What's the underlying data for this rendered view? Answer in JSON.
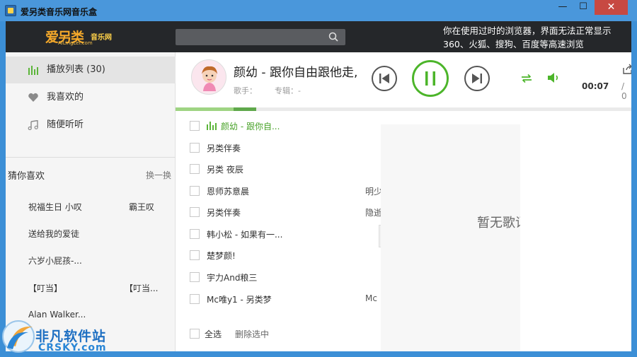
{
  "window": {
    "title": "爱另类音乐网音乐盒",
    "minimize": "—",
    "maximize": "☐",
    "close": "✕"
  },
  "header": {
    "logo_text": "爱另类",
    "logo_badge": "音乐网",
    "logo_sub": "AiLingLei.com",
    "search_placeholder": "",
    "warning_line1": "你在使用过时的浏览器，界面无法正常显示",
    "warning_line2": "360、火狐、搜狗、百度等高速浏览"
  },
  "sidebar": {
    "nav": [
      {
        "label": "播放列表 (30)",
        "icon": "equalizer-icon"
      },
      {
        "label": "我喜欢的",
        "icon": "heart-icon"
      },
      {
        "label": "随便听听",
        "icon": "music-note-icon"
      }
    ],
    "guess_title": "猜你喜欢",
    "guess_change": "换一换",
    "recommendations": [
      [
        "祝福生日 小叹",
        "霸王叹"
      ],
      [
        "送给我的爱徒",
        ""
      ],
      [
        "六岁小屁孩-...",
        ""
      ],
      [
        "【叮当】",
        "【叮当..."
      ],
      [
        "Alan Walker...",
        ""
      ]
    ]
  },
  "player": {
    "song_title": "颜幼 - 跟你自由跟他走,",
    "artist_label": "歌手：",
    "album_label": "专辑：-",
    "time_current": "00:07",
    "time_total": "/ 0",
    "progress": 0.13,
    "buffer": 0.05,
    "accent_color": "#4cb52a"
  },
  "playlist": {
    "items": [
      {
        "title": "颜幼 - 跟你自...",
        "artist": "",
        "playing": true
      },
      {
        "title": "另类伴奏",
        "artist": ""
      },
      {
        "title": "另类 夜辰",
        "artist": ""
      },
      {
        "title": "恩师苏意晨",
        "artist": "明少"
      },
      {
        "title": "另类伴奏",
        "artist": "隐逝"
      },
      {
        "title": "韩小松 - 如果有一...",
        "artist": ""
      },
      {
        "title": "楚梦颜!",
        "artist": ""
      },
      {
        "title": "宇力And粮三",
        "artist": ""
      },
      {
        "title": "Mc唯y1 - 另类梦",
        "artist": "Mc"
      }
    ],
    "select_all": "全选",
    "delete_selected": "删除选中"
  },
  "lyrics": {
    "empty_text": "暂无歌词显示"
  },
  "watermark": {
    "title": "非凡软件站",
    "sub": "CRSKY.com"
  }
}
